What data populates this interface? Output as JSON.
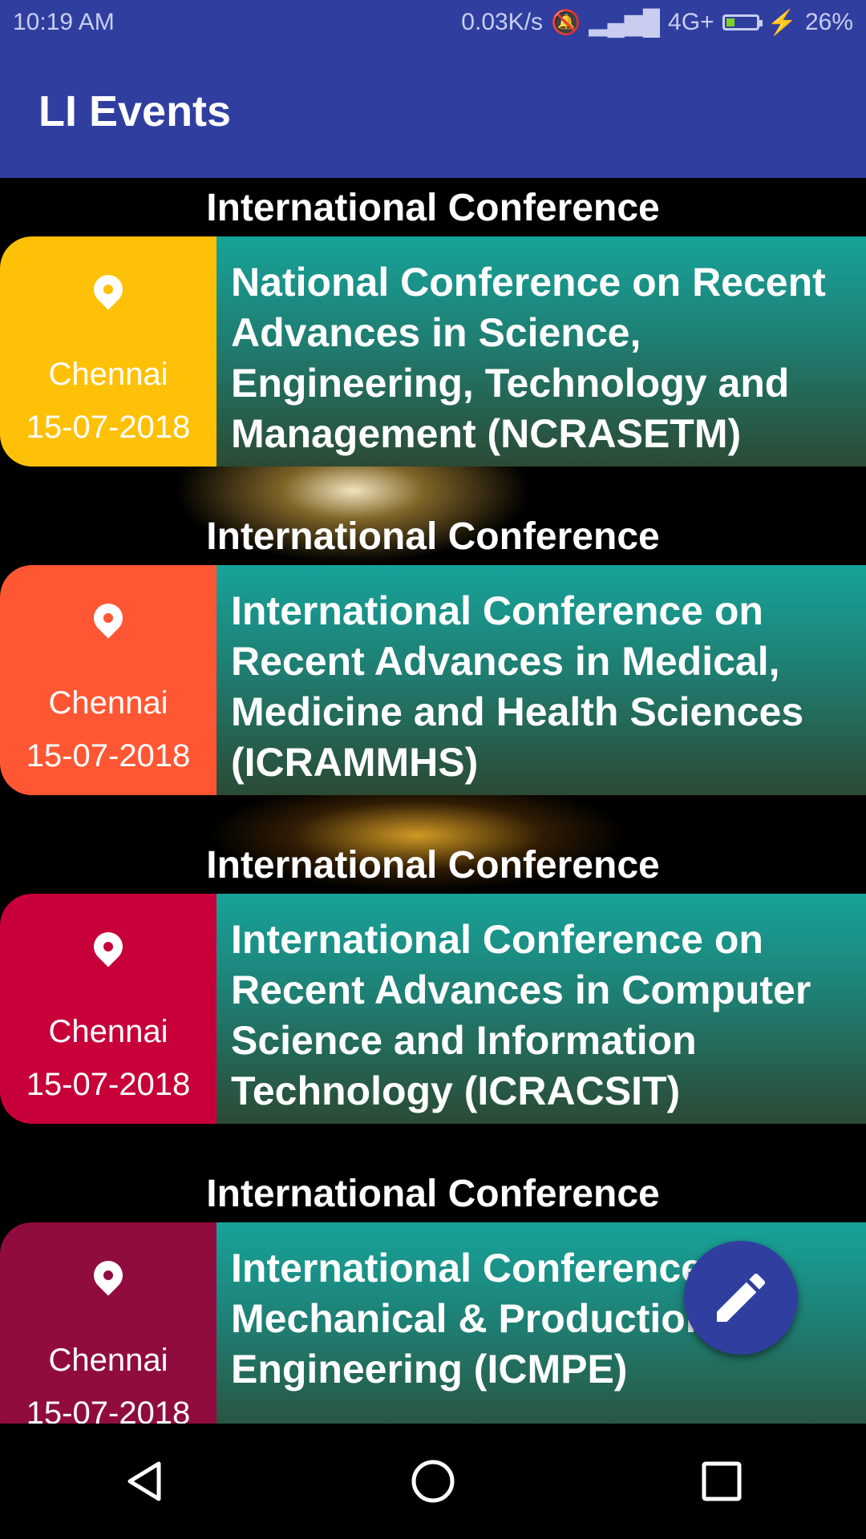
{
  "status_bar": {
    "time": "10:19 AM",
    "network_speed": "0.03K/s",
    "network_type": "4G+",
    "battery": "26%"
  },
  "app_bar": {
    "title": "LI Events"
  },
  "sections": [
    {
      "header": "International Conference",
      "card": {
        "accent_color": "#ffc107",
        "city": "Chennai",
        "date": "15-07-2018",
        "title": "National Conference on Recent Advances in Science, Engineering, Technology and Management (NCRASETM)"
      }
    },
    {
      "header": "International Conference",
      "card": {
        "accent_color": "#ff5733",
        "city": "Chennai",
        "date": "15-07-2018",
        "title": "International Conference on Recent Advances in Medical, Medicine and Health Sciences (ICRAMMHS)"
      }
    },
    {
      "header": "International Conference",
      "card": {
        "accent_color": "#c70039",
        "city": "Chennai",
        "date": "15-07-2018",
        "title": "International Conference on Recent Advances in Computer Science and Information Technology (ICRACSIT)"
      }
    },
    {
      "header": "International Conference",
      "card": {
        "accent_color": "#900c3f",
        "city": "Chennai",
        "date": "15-07-2018",
        "title": "International Conference on Mechanical & Production Engineering (ICMPE)"
      }
    }
  ],
  "fab": {
    "icon": "pencil-icon",
    "color": "#303f9f"
  },
  "nav_bar": {
    "icons": [
      "back-icon",
      "home-icon",
      "recents-icon"
    ]
  }
}
